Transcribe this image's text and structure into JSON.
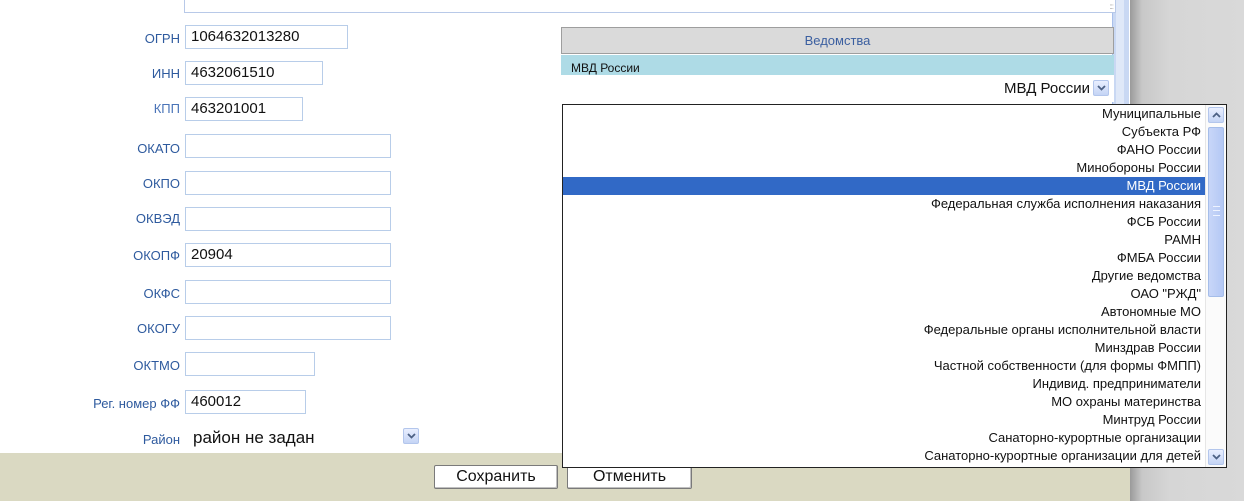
{
  "form": {
    "fields": [
      {
        "label": "ОГРН",
        "value": "1064632013280"
      },
      {
        "label": "ИНН",
        "value": "4632061510"
      },
      {
        "label": "КПП",
        "value": "463201001"
      },
      {
        "label": "ОКАТО",
        "value": ""
      },
      {
        "label": "ОКПО",
        "value": ""
      },
      {
        "label": "ОКВЭД",
        "value": ""
      },
      {
        "label": "ОКОПФ",
        "value": "20904"
      },
      {
        "label": "ОКФС",
        "value": ""
      },
      {
        "label": "ОКОГУ",
        "value": ""
      },
      {
        "label": "ОКТМО",
        "value": ""
      },
      {
        "label": "Рег. номер ФФ",
        "value": "460012"
      }
    ],
    "district": {
      "label": "Район",
      "value": "район не задан"
    }
  },
  "agencies": {
    "header": "Ведомства",
    "selected_row": "МВД России",
    "combo_value": "МВД России",
    "options": [
      "Муниципальные",
      "Субъекта РФ",
      "ФАНО России",
      "Минобороны России",
      "МВД России",
      "Федеральная служба исполнения наказания",
      "ФСБ России",
      "РАМН",
      "ФМБА России",
      "Другие ведомства",
      "ОАО \"РЖД\"",
      "Автономные МО",
      "Федеральные органы исполнительной власти",
      "Минздрав России",
      "Частной собственности (для формы ФМПП)",
      "Индивид. предприниматели",
      "МО охраны материнства",
      "Минтруд России",
      "Санаторно-курортные организации",
      "Санаторно-курортные организации для детей"
    ],
    "selected_index": 4
  },
  "buttons": {
    "save": "Сохранить",
    "cancel": "Отменить"
  },
  "colors": {
    "label": "#2e5a9e",
    "selection": "#3169c6",
    "bottom_bar": "#dad9c2",
    "header_bg": "#dadada",
    "selected_row_bg": "#aedbe6"
  },
  "icons": [
    "chevron-down-icon",
    "scroll-up-icon",
    "scroll-down-icon"
  ]
}
